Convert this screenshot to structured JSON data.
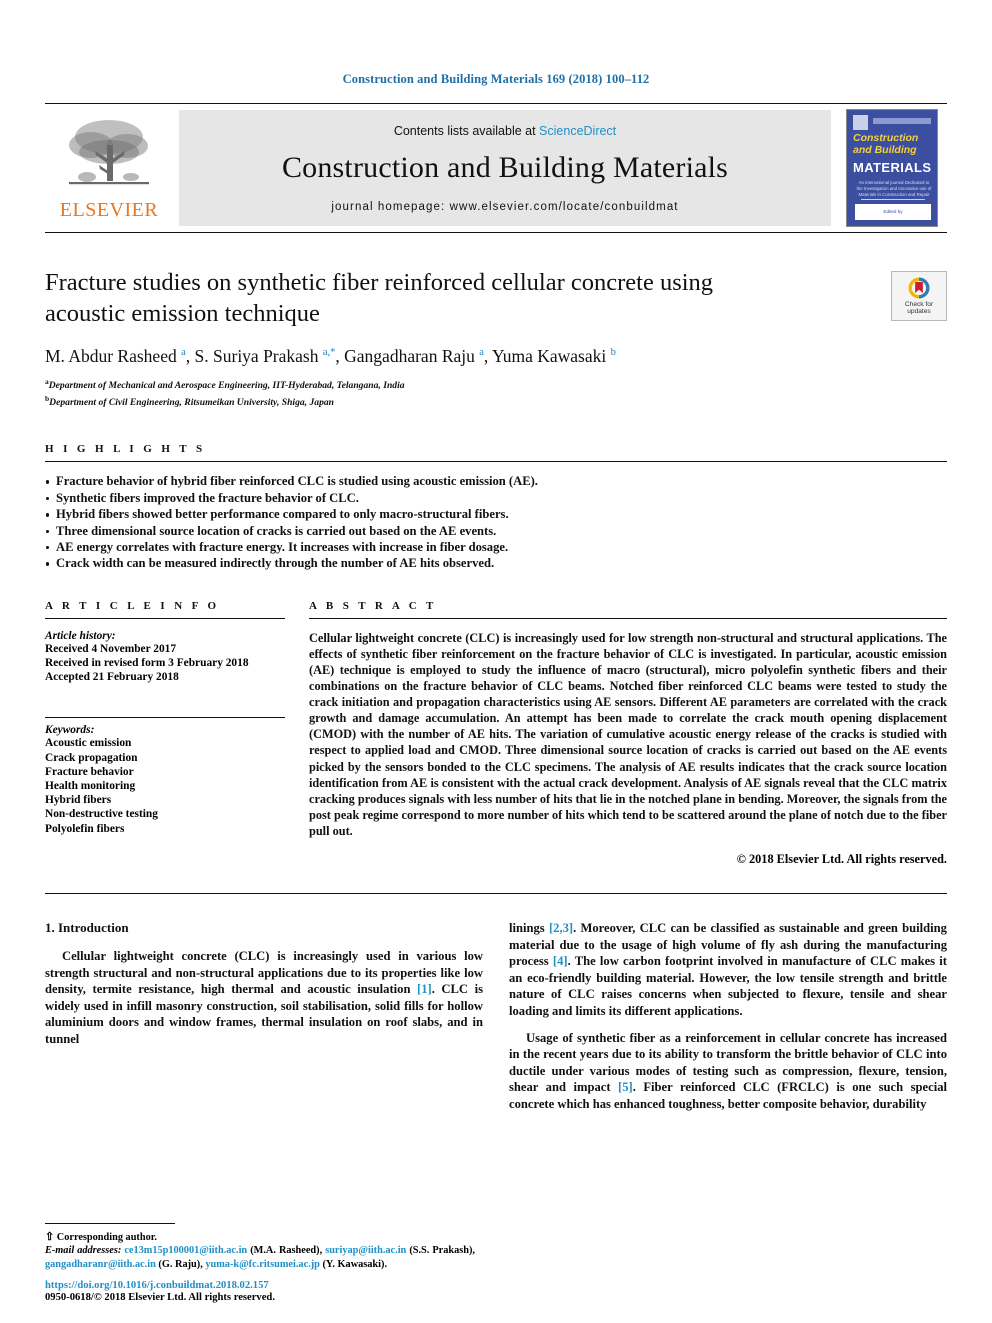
{
  "running_head": "Construction and Building Materials 169 (2018) 100–112",
  "banner": {
    "contents_prefix": "Contents lists available at ",
    "sciencedirect": "ScienceDirect",
    "journal_name": "Construction and Building Materials",
    "homepage": "journal homepage: www.elsevier.com/locate/conbuildmat",
    "publisher_word": "ELSEVIER",
    "publisher_color": "#e87722",
    "sciencedirect_color": "#1f8fc6",
    "cover": {
      "line1": "Construction",
      "line2": "and Building",
      "line3": "MATERIALS",
      "subtitle": "An international journal Dedicated to the Investigation and Innovative use of Materials in Construction and Repair",
      "footer": "Edited by",
      "bg_color": "#3b4ea0",
      "accent_color": "#f4d23c"
    }
  },
  "article": {
    "title": "Fracture studies on synthetic fiber reinforced cellular concrete using acoustic emission technique",
    "authors_html": "M. Abdur Rasheed <sup>a</sup>, S. Suriya Prakash <sup>a,</sup><sup>*</sup>, Gangadharan Raju <sup>a</sup>, Yuma Kawasaki <sup>b</sup>",
    "affiliations": [
      {
        "marker": "a",
        "text": "Department of Mechanical and Aerospace Engineering, IIT-Hyderabad, Telangana, India"
      },
      {
        "marker": "b",
        "text": "Department of Civil Engineering, Ritsumeikan University, Shiga, Japan"
      }
    ],
    "crossmark_line1": "Check for",
    "crossmark_line2": "updates"
  },
  "highlights": {
    "heading": "H I G H L I G H T S",
    "items": [
      "Fracture behavior of hybrid fiber reinforced CLC is studied using acoustic emission (AE).",
      "Synthetic fibers improved the fracture behavior of CLC.",
      "Hybrid fibers showed better performance compared to only macro-structural fibers.",
      "Three dimensional source location of cracks is carried out based on the AE events.",
      "AE energy correlates with fracture energy. It increases with increase in fiber dosage.",
      "Crack width can be measured indirectly through the number of AE hits observed."
    ]
  },
  "article_info": {
    "heading": "A R T I C L E    I N F O",
    "history_label": "Article history:",
    "history": [
      "Received 4 November 2017",
      "Received in revised form 3 February 2018",
      "Accepted 21 February 2018"
    ],
    "keywords_label": "Keywords:",
    "keywords": [
      "Acoustic emission",
      "Crack propagation",
      "Fracture behavior",
      "Health monitoring",
      "Hybrid fibers",
      "Non-destructive testing",
      "Polyolefin fibers"
    ]
  },
  "abstract": {
    "heading": "A B S T R A C T",
    "text": "Cellular lightweight concrete (CLC) is increasingly used for low strength non-structural and structural applications. The effects of synthetic fiber reinforcement on the fracture behavior of CLC is investigated. In particular, acoustic emission (AE) technique is employed to study the influence of macro (structural), micro polyolefin synthetic fibers and their combinations on the fracture behavior of CLC beams. Notched fiber reinforced CLC beams were tested to study the crack initiation and propagation characteristics using AE sensors. Different AE parameters are correlated with the crack growth and damage accumulation. An attempt has been made to correlate the crack mouth opening displacement (CMOD) with the number of AE hits. The variation of cumulative acoustic energy release of the cracks is studied with respect to applied load and CMOD. Three dimensional source location of cracks is carried out based on the AE events picked by the sensors bonded to the CLC specimens. The analysis of AE results indicates that the crack source location identification from AE is consistent with the actual crack development. Analysis of AE signals reveal that the CLC matrix cracking produces signals with less number of hits that lie in the notched plane in bending. Moreover, the signals from the post peak regime correspond to more number of hits which tend to be scattered around the plane of notch due to the fiber pull out.",
    "copyright": "© 2018 Elsevier Ltd. All rights reserved."
  },
  "introduction": {
    "section_title": "1. Introduction",
    "left_para_1_html": "Cellular lightweight concrete (CLC) is increasingly used in various low strength structural and non-structural applications due to its properties like low density, termite resistance, high thermal and acoustic insulation <span class=\"ref\">[1]</span>. CLC is widely used in infill masonry construction, soil stabilisation, solid fills for hollow aluminium doors and window frames, thermal insulation on roof slabs, and in tunnel",
    "right_para_1_html": "linings <span class=\"ref\">[2,3]</span>. Moreover, CLC can be classified as sustainable and green building material due to the usage of high volume of fly ash during the manufacturing process <span class=\"ref\">[4]</span>. The low carbon footprint involved in manufacture of CLC makes it an eco-friendly building material. However, the low tensile strength and brittle nature of CLC raises concerns when subjected to flexure, tensile and shear loading and limits its different applications.",
    "right_para_2_html": "Usage of synthetic fiber as a reinforcement in cellular concrete has increased in the recent years due to its ability to transform the brittle behavior of CLC into ductile under various modes of testing such as compression, flexure, tension, shear and impact <span class=\"ref\">[5]</span>. Fiber reinforced CLC (FRCLC) is one such special concrete which has enhanced toughness, better composite behavior, durability"
  },
  "footnote": {
    "corresponding_html": "<span style=\"font-size:11px\">&#8679;</span> Corresponding author.",
    "emails_html": "<span class=\"em\">E-mail addresses:</span> <span class=\"mail\">ce13m15p100001@iith.ac.in</span> (M.A. Rasheed), <span class=\"mail\">suriyap@iith.ac.in</span> (S.S. Prakash), <span class=\"mail\">gangadharanr@iith.ac.in</span> (G. Raju), <span class=\"mail\">yuma-k@fc.ritsumei.ac.jp</span> (Y. Kawasaki).",
    "doi": "https://doi.org/10.1016/j.conbuildmat.2018.02.157",
    "issn": "0950-0618/© 2018 Elsevier Ltd. All rights reserved."
  }
}
